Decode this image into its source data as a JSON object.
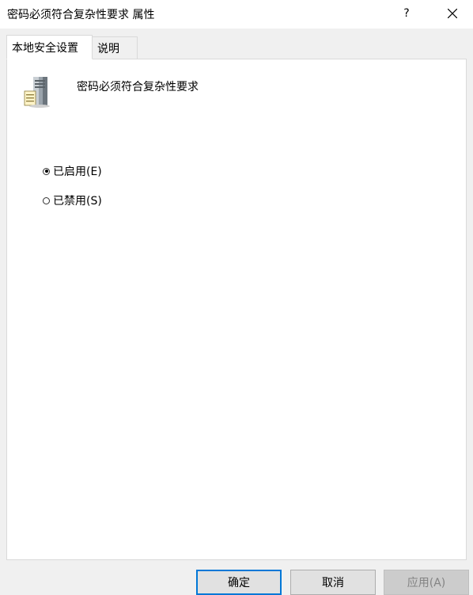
{
  "window": {
    "title": "密码必须符合复杂性要求 属性",
    "help_label": "?"
  },
  "tabs": [
    {
      "label": "本地安全设置",
      "active": true
    },
    {
      "label": "说明",
      "active": false
    }
  ],
  "policy": {
    "name": "密码必须符合复杂性要求",
    "icon": "server-policy-icon"
  },
  "options": [
    {
      "label": "已启用(E)",
      "selected": true
    },
    {
      "label": "已禁用(S)",
      "selected": false
    }
  ],
  "buttons": {
    "ok": "确定",
    "cancel": "取消",
    "apply": "应用(A)"
  },
  "colors": {
    "accent": "#0078d7",
    "dialog_bg": "#f0f0f0",
    "panel_bg": "#ffffff"
  }
}
